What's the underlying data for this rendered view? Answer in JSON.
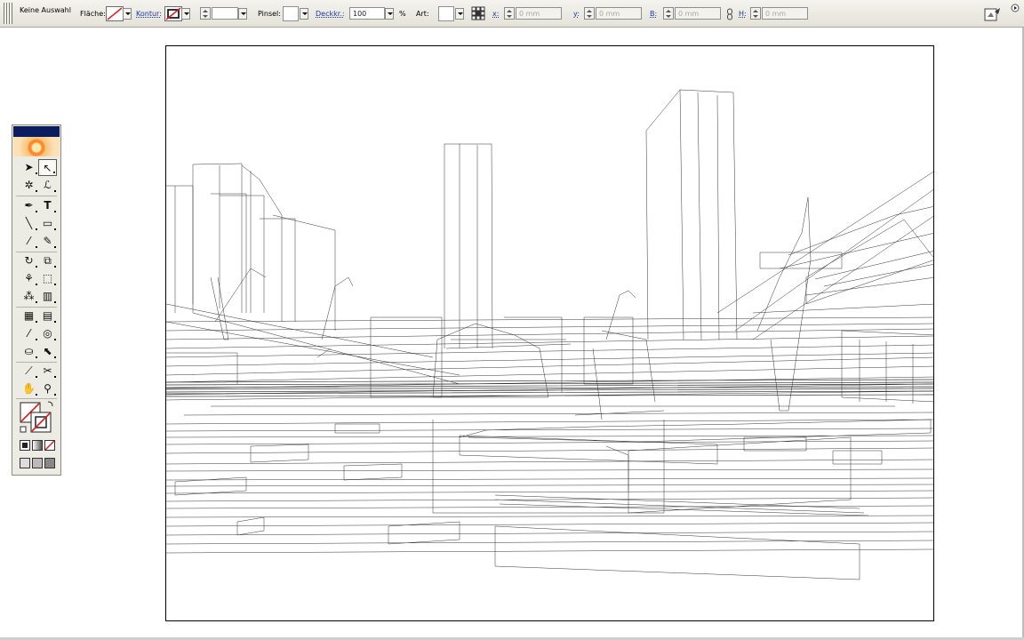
{
  "controlbar": {
    "selection_label": "Keine Auswahl",
    "fill_label": "Fläche:",
    "stroke_label": "Kontur:",
    "brush_label": "Pinsel:",
    "opacity_label": "Deckkr.:",
    "opacity_value": "100",
    "opacity_unit": "%",
    "style_label": "Art:",
    "x_label": "x:",
    "x_value": "0 mm",
    "y_label": "y:",
    "y_value": "0 mm",
    "w_label": "B:",
    "w_value": "0 mm",
    "h_label": "H:",
    "h_value": "0 mm"
  },
  "toolbox": {
    "tools": [
      {
        "name": "selection-tool",
        "glyph": "➤"
      },
      {
        "name": "direct-selection-tool",
        "glyph": "↖"
      },
      {
        "name": "magic-wand-tool",
        "glyph": "✲"
      },
      {
        "name": "lasso-tool",
        "glyph": "ℒ"
      },
      {
        "name": "pen-tool",
        "glyph": "✒"
      },
      {
        "name": "type-tool",
        "glyph": "T"
      },
      {
        "name": "line-tool",
        "glyph": "╲"
      },
      {
        "name": "rectangle-tool",
        "glyph": "▭"
      },
      {
        "name": "paintbrush-tool",
        "glyph": "⁄"
      },
      {
        "name": "pencil-tool",
        "glyph": "✎"
      },
      {
        "name": "rotate-tool",
        "glyph": "↻"
      },
      {
        "name": "scale-tool",
        "glyph": "⧉"
      },
      {
        "name": "warp-tool",
        "glyph": "⚘"
      },
      {
        "name": "free-transform-tool",
        "glyph": "⬚"
      },
      {
        "name": "symbol-sprayer-tool",
        "glyph": "⁂"
      },
      {
        "name": "column-graph-tool",
        "glyph": "▥"
      },
      {
        "name": "mesh-tool",
        "glyph": "▦"
      },
      {
        "name": "gradient-tool",
        "glyph": "▤"
      },
      {
        "name": "eyedropper-tool",
        "glyph": "⁄"
      },
      {
        "name": "blend-tool",
        "glyph": "◎"
      },
      {
        "name": "live-paint-bucket-tool",
        "glyph": "⛀"
      },
      {
        "name": "live-paint-selection-tool",
        "glyph": "⬉"
      },
      {
        "name": "slice-tool",
        "glyph": "⟋"
      },
      {
        "name": "scissors-tool",
        "glyph": "✂"
      },
      {
        "name": "hand-tool",
        "glyph": "✋"
      },
      {
        "name": "zoom-tool",
        "glyph": "⚲"
      }
    ],
    "fill_stroke_colors": {
      "fill": "#ffffff",
      "stroke": "#ffffff",
      "none_slash": "#e21b1b"
    }
  },
  "colors": {
    "controlbar_bg": "#e9e7de",
    "toolbox_title": "#0b1d5e",
    "link_blue": "#1d3aa0",
    "artboard_border": "#000000"
  }
}
